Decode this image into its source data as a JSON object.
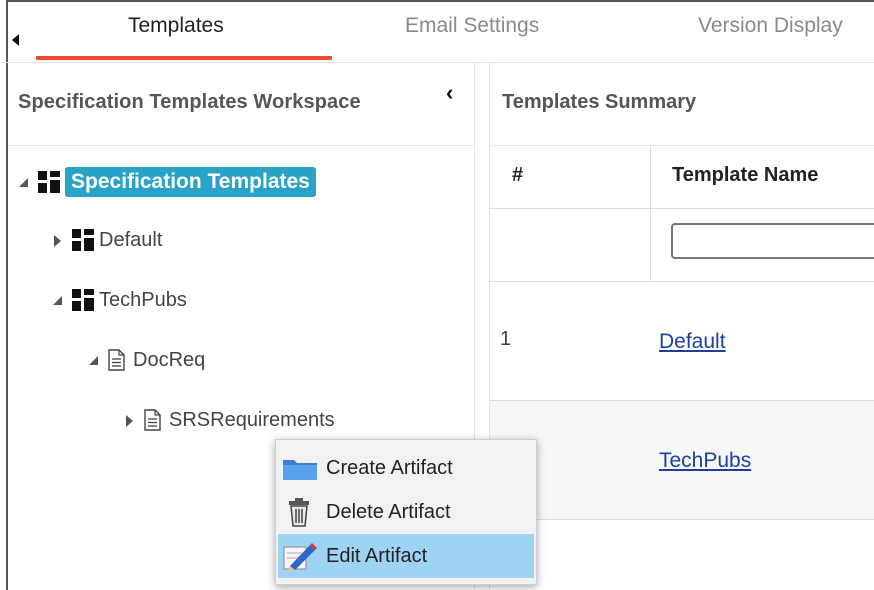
{
  "tabs": [
    {
      "label": "Templates",
      "active": true
    },
    {
      "label": "Email Settings",
      "active": false
    },
    {
      "label": "Version Display",
      "active": false
    }
  ],
  "workspace": {
    "title": "Specification Templates Workspace",
    "tree": {
      "root": "Specification Templates",
      "nodes": [
        "Default",
        "TechPubs",
        "DocReq",
        "SRSRequirements"
      ]
    }
  },
  "summary": {
    "title": "Templates Summary",
    "columns": [
      "#",
      "Template Name"
    ],
    "filter_value": "",
    "rows": [
      {
        "num": "1",
        "name": "Default"
      },
      {
        "num": "",
        "name": "TechPubs"
      }
    ]
  },
  "context_menu": {
    "items": [
      {
        "label": "Create Artifact",
        "icon": "folder-icon"
      },
      {
        "label": "Delete Artifact",
        "icon": "trash-icon"
      },
      {
        "label": "Edit Artifact",
        "icon": "edit-pencil-icon",
        "highlighted": true
      }
    ]
  },
  "colors": {
    "tab_accent": "#ef4a2e",
    "selected_node": "#2aa3c9",
    "menu_highlight": "#9ed3f4",
    "link": "#1f3f9e"
  }
}
